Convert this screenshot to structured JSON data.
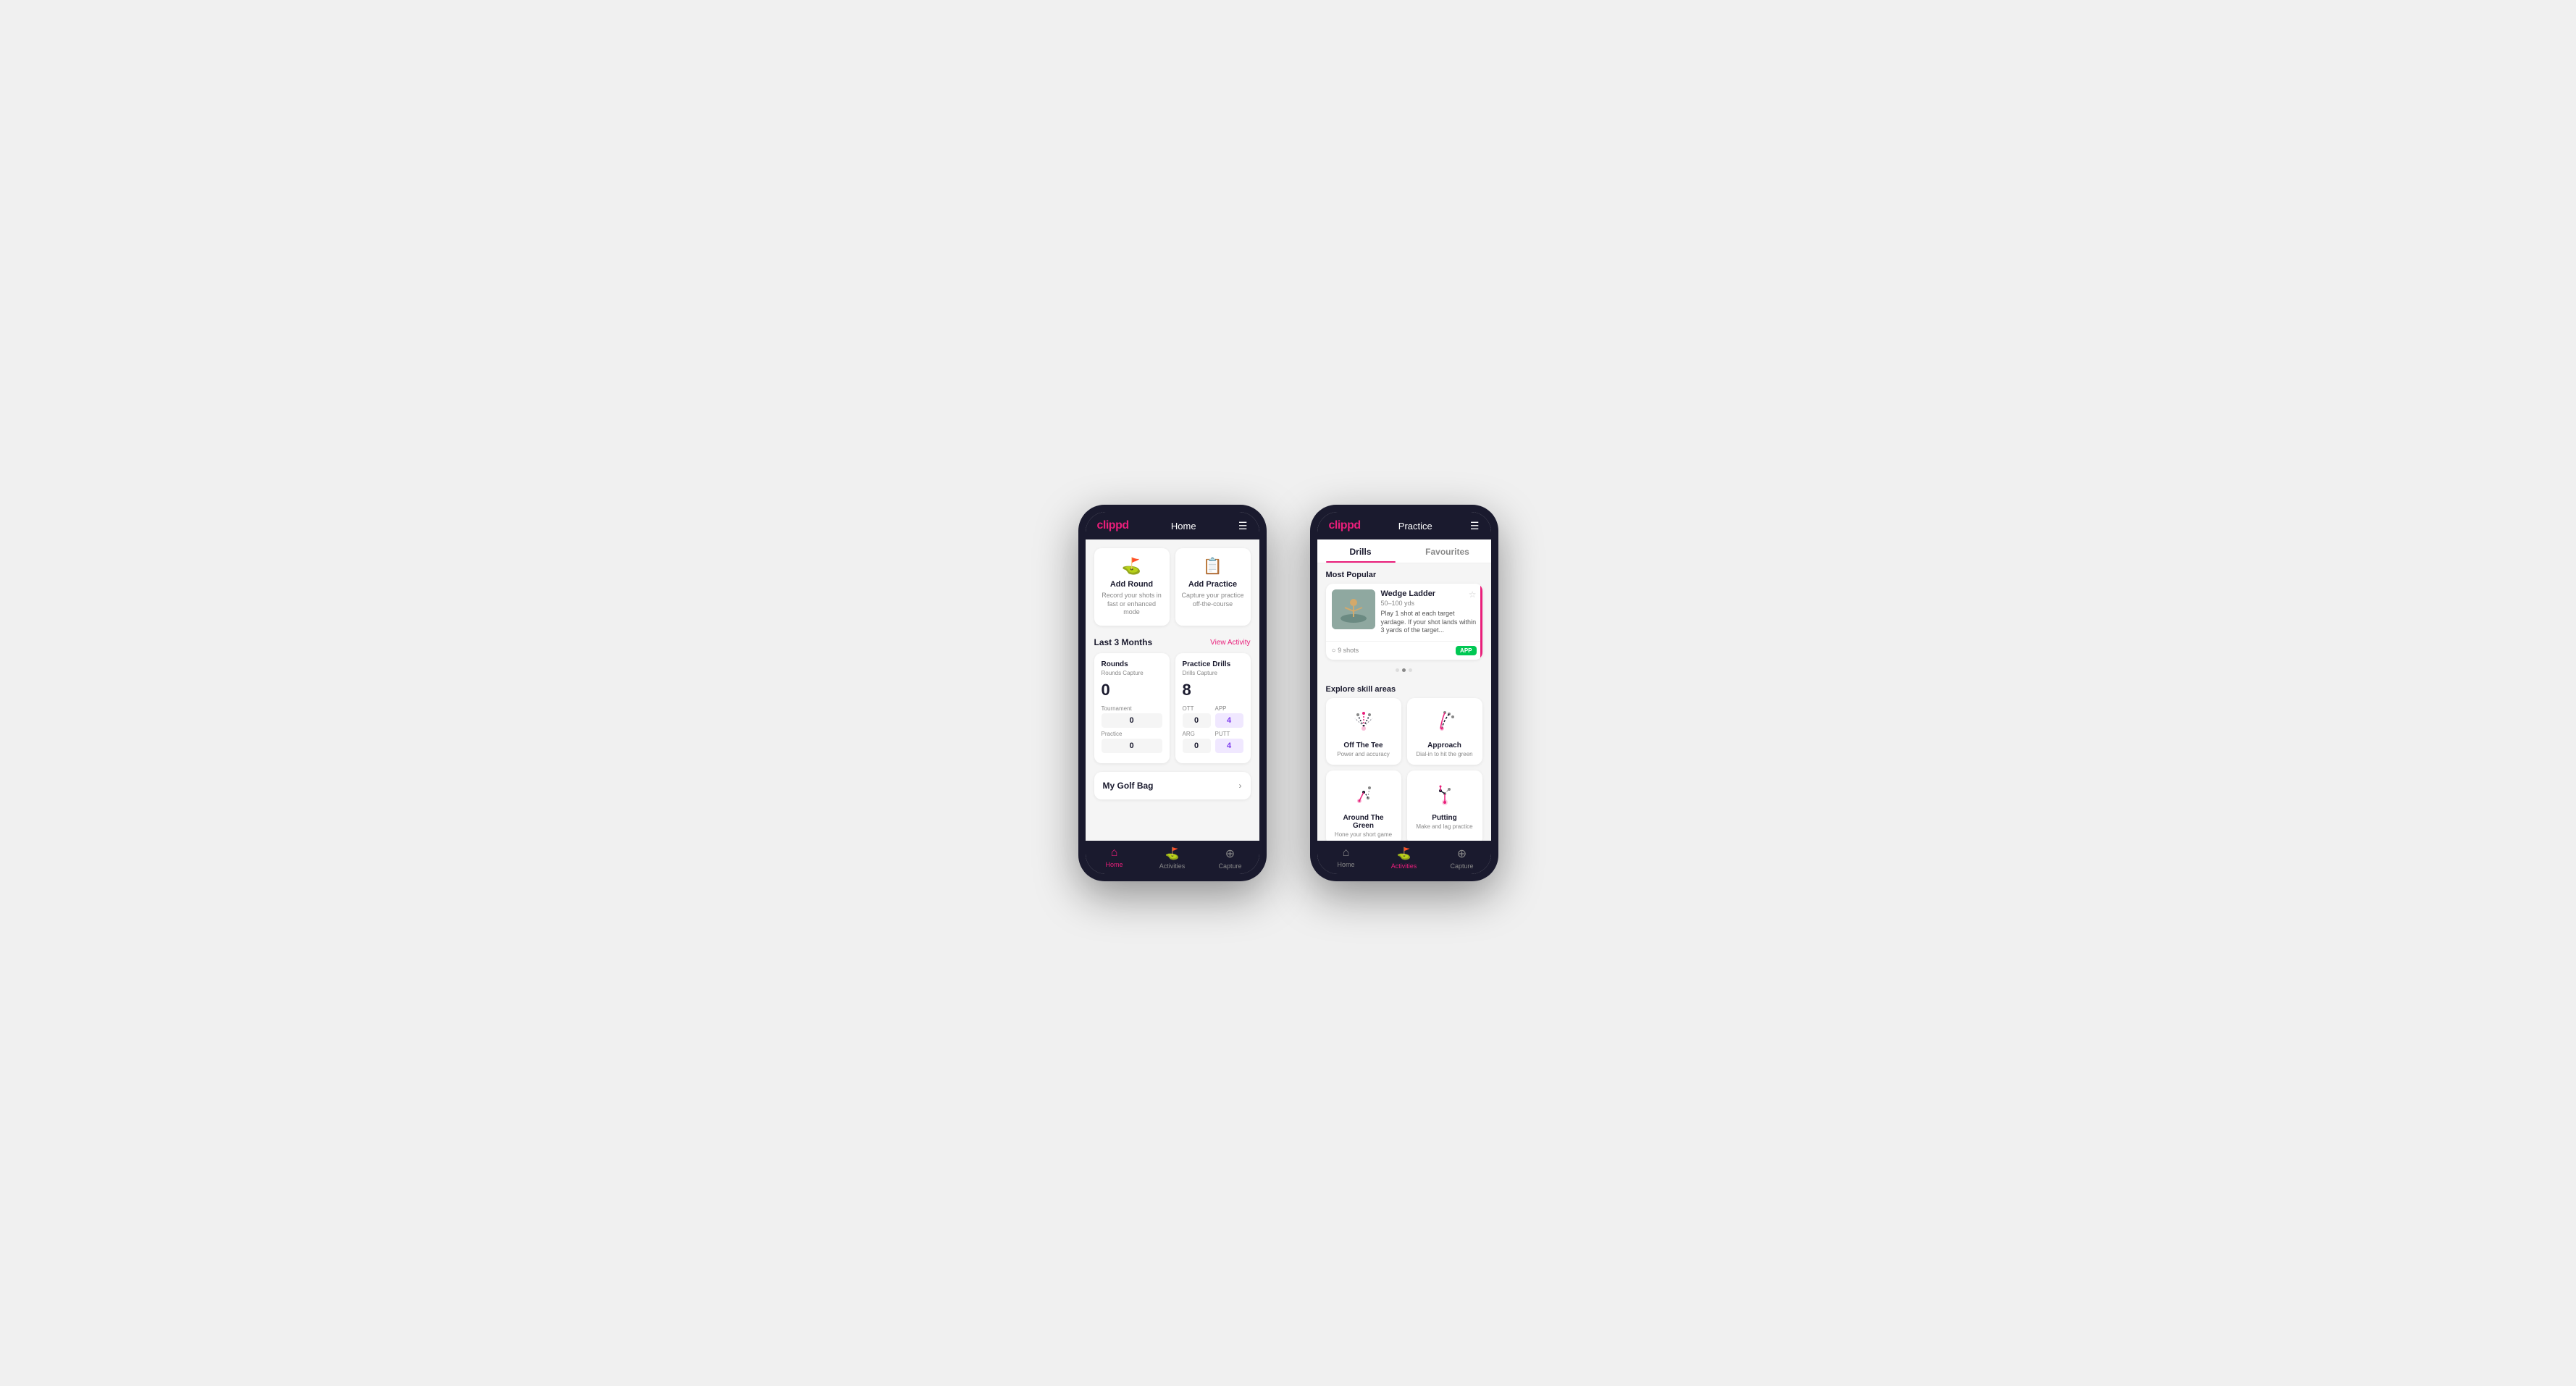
{
  "phone1": {
    "header": {
      "logo": "clippd",
      "title": "Home",
      "menu_icon": "☰"
    },
    "action_cards": [
      {
        "id": "add-round",
        "icon": "⛳",
        "title": "Add Round",
        "description": "Record your shots in fast or enhanced mode"
      },
      {
        "id": "add-practice",
        "icon": "📋",
        "title": "Add Practice",
        "description": "Capture your practice off-the-course"
      }
    ],
    "stats": {
      "header": "Last 3 Months",
      "view_activity": "View Activity",
      "rounds": {
        "title": "Rounds",
        "subtitle": "Rounds Capture",
        "total": "0",
        "rows": [
          {
            "label": "Tournament",
            "value": "0"
          },
          {
            "label": "Practice",
            "value": "0"
          }
        ]
      },
      "drills": {
        "title": "Practice Drills",
        "subtitle": "Drills Capture",
        "total": "8",
        "rows": [
          {
            "label": "OTT",
            "value": "0"
          },
          {
            "label": "APP",
            "value": "4",
            "highlighted": true
          },
          {
            "label": "ARG",
            "value": "0"
          },
          {
            "label": "PUTT",
            "value": "4",
            "highlighted": true
          }
        ]
      }
    },
    "golf_bag": {
      "label": "My Golf Bag"
    },
    "bottom_nav": [
      {
        "icon": "🏠",
        "label": "Home",
        "active": true
      },
      {
        "icon": "⛳",
        "label": "Activities",
        "active": false
      },
      {
        "icon": "➕",
        "label": "Capture",
        "active": false
      }
    ]
  },
  "phone2": {
    "header": {
      "logo": "clippd",
      "title": "Practice",
      "menu_icon": "☰"
    },
    "tabs": [
      {
        "label": "Drills",
        "active": true
      },
      {
        "label": "Favourites",
        "active": false
      }
    ],
    "most_popular": {
      "label": "Most Popular",
      "drill": {
        "title": "Wedge Ladder",
        "distance": "50–100 yds",
        "description": "Play 1 shot at each target yardage. If your shot lands within 3 yards of the target...",
        "shots": "9 shots",
        "badge": "APP"
      },
      "dots": [
        {
          "active": false
        },
        {
          "active": true
        },
        {
          "active": false
        }
      ]
    },
    "explore": {
      "label": "Explore skill areas",
      "areas": [
        {
          "id": "off-the-tee",
          "title": "Off The Tee",
          "description": "Power and accuracy"
        },
        {
          "id": "approach",
          "title": "Approach",
          "description": "Dial-in to hit the green"
        },
        {
          "id": "around-the-green",
          "title": "Around The Green",
          "description": "Hone your short game"
        },
        {
          "id": "putting",
          "title": "Putting",
          "description": "Make and lag practice"
        }
      ]
    },
    "bottom_nav": [
      {
        "icon": "🏠",
        "label": "Home",
        "active": false
      },
      {
        "icon": "⛳",
        "label": "Activities",
        "active": true
      },
      {
        "icon": "➕",
        "label": "Capture",
        "active": false
      }
    ]
  }
}
